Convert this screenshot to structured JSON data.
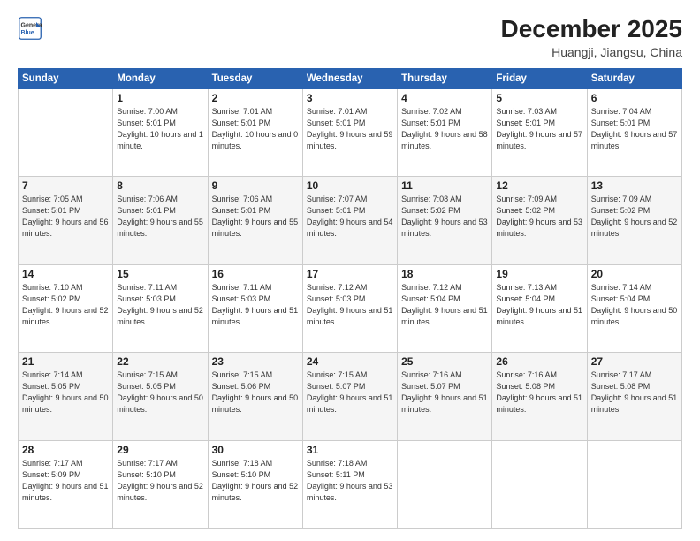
{
  "logo": {
    "line1": "General",
    "line2": "Blue"
  },
  "header": {
    "month": "December 2025",
    "location": "Huangji, Jiangsu, China"
  },
  "weekdays": [
    "Sunday",
    "Monday",
    "Tuesday",
    "Wednesday",
    "Thursday",
    "Friday",
    "Saturday"
  ],
  "weeks": [
    [
      {
        "day": "",
        "sunrise": "",
        "sunset": "",
        "daylight": ""
      },
      {
        "day": "1",
        "sunrise": "Sunrise: 7:00 AM",
        "sunset": "Sunset: 5:01 PM",
        "daylight": "Daylight: 10 hours and 1 minute."
      },
      {
        "day": "2",
        "sunrise": "Sunrise: 7:01 AM",
        "sunset": "Sunset: 5:01 PM",
        "daylight": "Daylight: 10 hours and 0 minutes."
      },
      {
        "day": "3",
        "sunrise": "Sunrise: 7:01 AM",
        "sunset": "Sunset: 5:01 PM",
        "daylight": "Daylight: 9 hours and 59 minutes."
      },
      {
        "day": "4",
        "sunrise": "Sunrise: 7:02 AM",
        "sunset": "Sunset: 5:01 PM",
        "daylight": "Daylight: 9 hours and 58 minutes."
      },
      {
        "day": "5",
        "sunrise": "Sunrise: 7:03 AM",
        "sunset": "Sunset: 5:01 PM",
        "daylight": "Daylight: 9 hours and 57 minutes."
      },
      {
        "day": "6",
        "sunrise": "Sunrise: 7:04 AM",
        "sunset": "Sunset: 5:01 PM",
        "daylight": "Daylight: 9 hours and 57 minutes."
      }
    ],
    [
      {
        "day": "7",
        "sunrise": "Sunrise: 7:05 AM",
        "sunset": "Sunset: 5:01 PM",
        "daylight": "Daylight: 9 hours and 56 minutes."
      },
      {
        "day": "8",
        "sunrise": "Sunrise: 7:06 AM",
        "sunset": "Sunset: 5:01 PM",
        "daylight": "Daylight: 9 hours and 55 minutes."
      },
      {
        "day": "9",
        "sunrise": "Sunrise: 7:06 AM",
        "sunset": "Sunset: 5:01 PM",
        "daylight": "Daylight: 9 hours and 55 minutes."
      },
      {
        "day": "10",
        "sunrise": "Sunrise: 7:07 AM",
        "sunset": "Sunset: 5:01 PM",
        "daylight": "Daylight: 9 hours and 54 minutes."
      },
      {
        "day": "11",
        "sunrise": "Sunrise: 7:08 AM",
        "sunset": "Sunset: 5:02 PM",
        "daylight": "Daylight: 9 hours and 53 minutes."
      },
      {
        "day": "12",
        "sunrise": "Sunrise: 7:09 AM",
        "sunset": "Sunset: 5:02 PM",
        "daylight": "Daylight: 9 hours and 53 minutes."
      },
      {
        "day": "13",
        "sunrise": "Sunrise: 7:09 AM",
        "sunset": "Sunset: 5:02 PM",
        "daylight": "Daylight: 9 hours and 52 minutes."
      }
    ],
    [
      {
        "day": "14",
        "sunrise": "Sunrise: 7:10 AM",
        "sunset": "Sunset: 5:02 PM",
        "daylight": "Daylight: 9 hours and 52 minutes."
      },
      {
        "day": "15",
        "sunrise": "Sunrise: 7:11 AM",
        "sunset": "Sunset: 5:03 PM",
        "daylight": "Daylight: 9 hours and 52 minutes."
      },
      {
        "day": "16",
        "sunrise": "Sunrise: 7:11 AM",
        "sunset": "Sunset: 5:03 PM",
        "daylight": "Daylight: 9 hours and 51 minutes."
      },
      {
        "day": "17",
        "sunrise": "Sunrise: 7:12 AM",
        "sunset": "Sunset: 5:03 PM",
        "daylight": "Daylight: 9 hours and 51 minutes."
      },
      {
        "day": "18",
        "sunrise": "Sunrise: 7:12 AM",
        "sunset": "Sunset: 5:04 PM",
        "daylight": "Daylight: 9 hours and 51 minutes."
      },
      {
        "day": "19",
        "sunrise": "Sunrise: 7:13 AM",
        "sunset": "Sunset: 5:04 PM",
        "daylight": "Daylight: 9 hours and 51 minutes."
      },
      {
        "day": "20",
        "sunrise": "Sunrise: 7:14 AM",
        "sunset": "Sunset: 5:04 PM",
        "daylight": "Daylight: 9 hours and 50 minutes."
      }
    ],
    [
      {
        "day": "21",
        "sunrise": "Sunrise: 7:14 AM",
        "sunset": "Sunset: 5:05 PM",
        "daylight": "Daylight: 9 hours and 50 minutes."
      },
      {
        "day": "22",
        "sunrise": "Sunrise: 7:15 AM",
        "sunset": "Sunset: 5:05 PM",
        "daylight": "Daylight: 9 hours and 50 minutes."
      },
      {
        "day": "23",
        "sunrise": "Sunrise: 7:15 AM",
        "sunset": "Sunset: 5:06 PM",
        "daylight": "Daylight: 9 hours and 50 minutes."
      },
      {
        "day": "24",
        "sunrise": "Sunrise: 7:15 AM",
        "sunset": "Sunset: 5:07 PM",
        "daylight": "Daylight: 9 hours and 51 minutes."
      },
      {
        "day": "25",
        "sunrise": "Sunrise: 7:16 AM",
        "sunset": "Sunset: 5:07 PM",
        "daylight": "Daylight: 9 hours and 51 minutes."
      },
      {
        "day": "26",
        "sunrise": "Sunrise: 7:16 AM",
        "sunset": "Sunset: 5:08 PM",
        "daylight": "Daylight: 9 hours and 51 minutes."
      },
      {
        "day": "27",
        "sunrise": "Sunrise: 7:17 AM",
        "sunset": "Sunset: 5:08 PM",
        "daylight": "Daylight: 9 hours and 51 minutes."
      }
    ],
    [
      {
        "day": "28",
        "sunrise": "Sunrise: 7:17 AM",
        "sunset": "Sunset: 5:09 PM",
        "daylight": "Daylight: 9 hours and 51 minutes."
      },
      {
        "day": "29",
        "sunrise": "Sunrise: 7:17 AM",
        "sunset": "Sunset: 5:10 PM",
        "daylight": "Daylight: 9 hours and 52 minutes."
      },
      {
        "day": "30",
        "sunrise": "Sunrise: 7:18 AM",
        "sunset": "Sunset: 5:10 PM",
        "daylight": "Daylight: 9 hours and 52 minutes."
      },
      {
        "day": "31",
        "sunrise": "Sunrise: 7:18 AM",
        "sunset": "Sunset: 5:11 PM",
        "daylight": "Daylight: 9 hours and 53 minutes."
      },
      {
        "day": "",
        "sunrise": "",
        "sunset": "",
        "daylight": ""
      },
      {
        "day": "",
        "sunrise": "",
        "sunset": "",
        "daylight": ""
      },
      {
        "day": "",
        "sunrise": "",
        "sunset": "",
        "daylight": ""
      }
    ]
  ]
}
